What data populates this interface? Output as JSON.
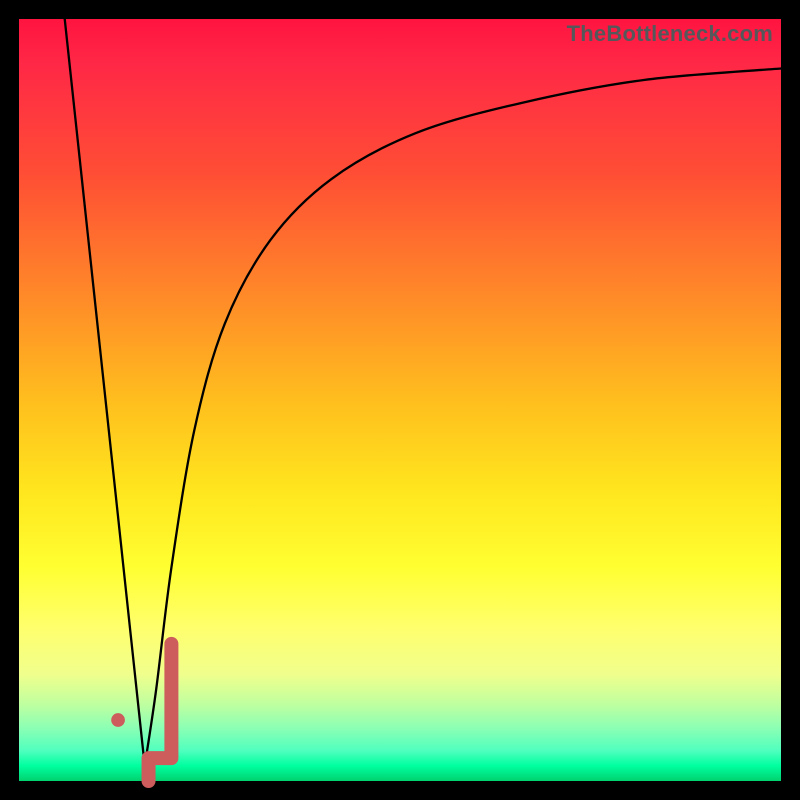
{
  "watermark": "TheBottleneck.com",
  "colors": {
    "curve": "#000000",
    "marker": "#cd5c5c",
    "frame": "#000000"
  },
  "chart_data": {
    "type": "line",
    "title": "",
    "xlabel": "",
    "ylabel": "",
    "xlim": [
      0,
      100
    ],
    "ylim": [
      0,
      100
    ],
    "grid": false,
    "series": [
      {
        "name": "left-edge",
        "x": [
          6,
          16.5
        ],
        "y": [
          100,
          2
        ]
      },
      {
        "name": "right-curve",
        "x": [
          16.5,
          18,
          20,
          23,
          27,
          33,
          41,
          52,
          66,
          82,
          100
        ],
        "y": [
          2,
          12,
          28,
          46,
          60,
          71,
          79,
          85,
          89,
          92,
          93.5
        ]
      }
    ],
    "markers": [
      {
        "name": "j-stroke",
        "points_x": [
          17,
          17,
          20,
          20
        ],
        "points_y": [
          0,
          3,
          3,
          18
        ]
      },
      {
        "name": "dot",
        "x": 13,
        "y": 8,
        "r": 0.9
      }
    ],
    "legend": false
  }
}
